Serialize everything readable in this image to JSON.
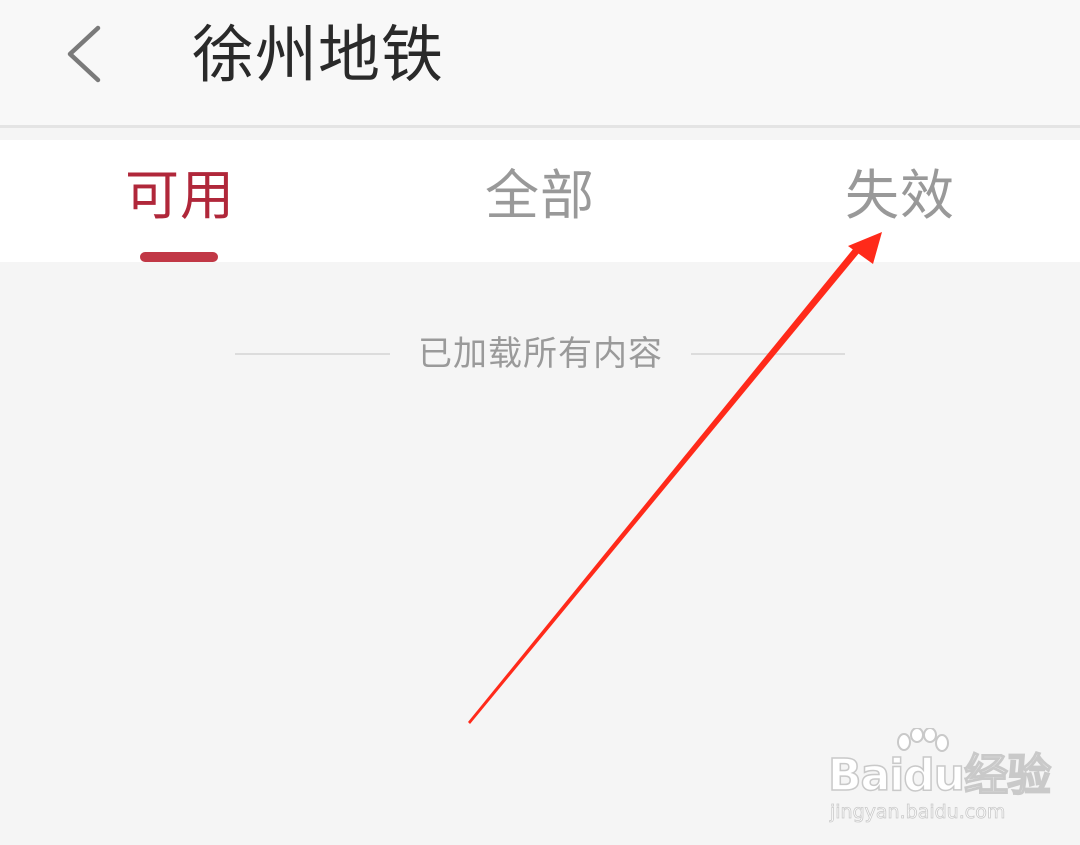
{
  "header": {
    "title": "徐州地铁",
    "back_icon": "chevron-left-icon"
  },
  "tabs": [
    {
      "label": "可用",
      "active": true
    },
    {
      "label": "全部",
      "active": false
    },
    {
      "label": "失效",
      "active": false
    }
  ],
  "content": {
    "end_message": "已加载所有内容"
  },
  "annotation": {
    "type": "red-arrow",
    "points_to": "tab 失效",
    "color": "#ff2a1a"
  },
  "watermark": {
    "brand": "Baidu经验",
    "url": "jingyan.baidu.com",
    "icon": "paw-icon"
  },
  "colors": {
    "accent": "#b0273a",
    "indicator": "#c13846",
    "inactive_tab": "#999999",
    "title": "#2a2a2a",
    "background": "#f5f5f5"
  }
}
